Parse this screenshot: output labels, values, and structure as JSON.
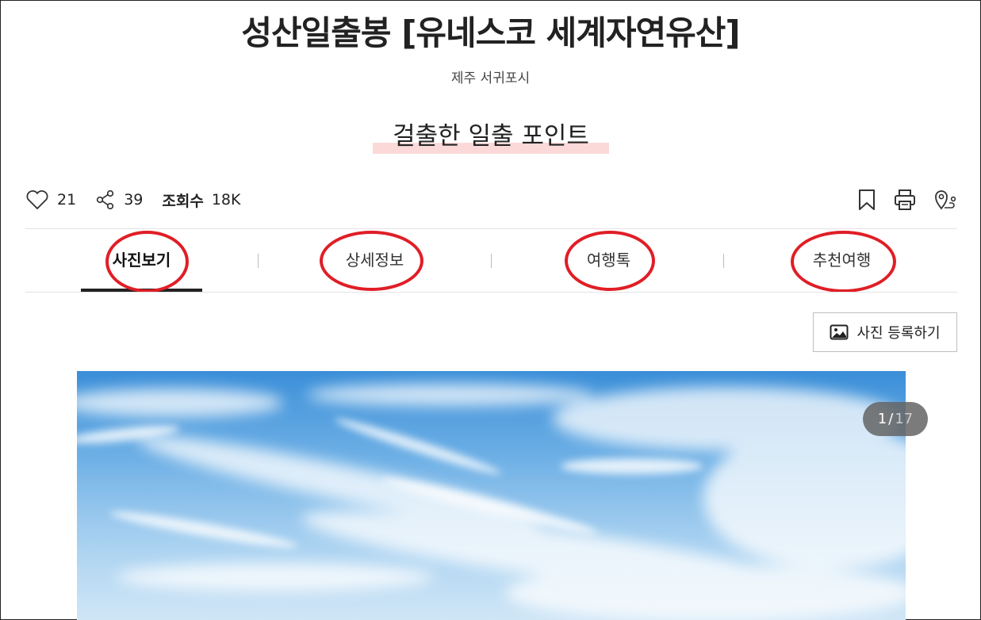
{
  "title": "성산일출봉 [유네스코 세계자연유산]",
  "location": "제주 서귀포시",
  "tagline": "걸출한 일출 포인트",
  "stats": {
    "likes": "21",
    "shares": "39",
    "views_label": "조회수",
    "views": "18K"
  },
  "icons": {
    "like": "heart-icon",
    "share": "share-icon",
    "bookmark": "bookmark-icon",
    "print": "print-icon",
    "route": "route-icon",
    "image": "image-icon"
  },
  "tabs": [
    {
      "label": "사진보기",
      "active": true
    },
    {
      "label": "상세정보"
    },
    {
      "label": "여행톡"
    },
    {
      "label": "추천여행"
    }
  ],
  "upload_button": "사진 등록하기",
  "gallery": {
    "current": "1",
    "separator": "/",
    "total": "17"
  },
  "colors": {
    "annotation": "#e01e26",
    "highlight": "#fbd9d9",
    "sky": "#4a9ce0"
  }
}
